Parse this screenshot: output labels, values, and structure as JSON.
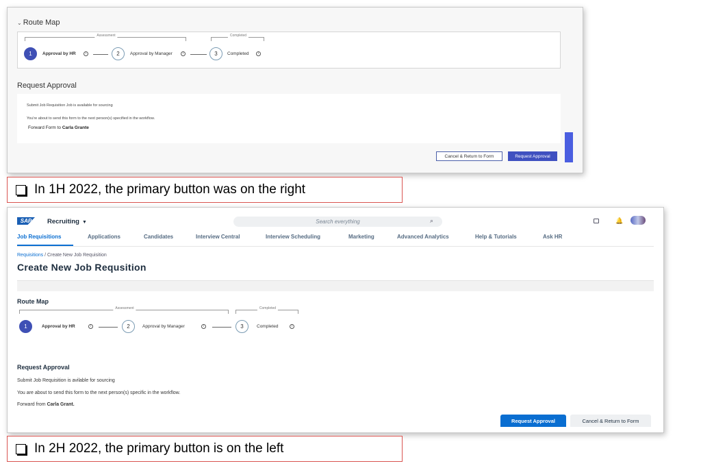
{
  "shot1": {
    "route_map_title": "Route Map",
    "brackets": {
      "assessment": "Assessment",
      "completed": "Completed"
    },
    "steps": [
      {
        "number": "1",
        "label": "Approval by HR"
      },
      {
        "number": "2",
        "label": "Approval by Manager"
      },
      {
        "number": "3",
        "label": "Completed"
      }
    ],
    "request_approval_title": "Request Approval",
    "line1": "Submit Job Requisition Job is available for sourcing",
    "line2": "You're about to send this form to the next person(s) specified in the workflow.",
    "forward_label": "Forward Form to",
    "forward_name": "Carla Grante",
    "cancel_button": "Cancel & Return to Form",
    "request_button": "Request Approval"
  },
  "caption1": "In 1H 2022, the primary button was on the right",
  "shot2": {
    "logo": "SAP",
    "app_title": "Recruiting",
    "search_placeholder": "Search everything",
    "nav": [
      "Job Requisitions",
      "Applications",
      "Candidates",
      "Interview Central",
      "Interview Scheduling",
      "Marketing",
      "Advanced Analytics",
      "Help & Tutorials",
      "Ask HR"
    ],
    "breadcrumb_link": "Requisitions",
    "breadcrumb_rest": " / Create New Job Requisition",
    "page_title": "Create New Job Requsition",
    "route_map_title": "Route Map",
    "brackets": {
      "assessment": "Assessment",
      "completed": "Completed"
    },
    "steps": [
      {
        "number": "1",
        "label": "Approval by HR"
      },
      {
        "number": "2",
        "label": "Approval by Manager"
      },
      {
        "number": "3",
        "label": "Completed"
      }
    ],
    "request_approval_title": "Request Approval",
    "line1": "Submit  Job Requisition is avilable for sourcing",
    "line2": "You are about to send this form to the next person(s) specific in the workflow.",
    "forward_label": "Forward from",
    "forward_name": "Carla Grant.",
    "request_button": "Request Approval",
    "cancel_button": "Cancel & Return to Form"
  },
  "caption2": "In 2H 2022, the primary button is on the left",
  "colors": {
    "s1_primary": "#3f50c0",
    "s2_primary": "#0a6ed1",
    "caption_border": "#d9534f"
  }
}
